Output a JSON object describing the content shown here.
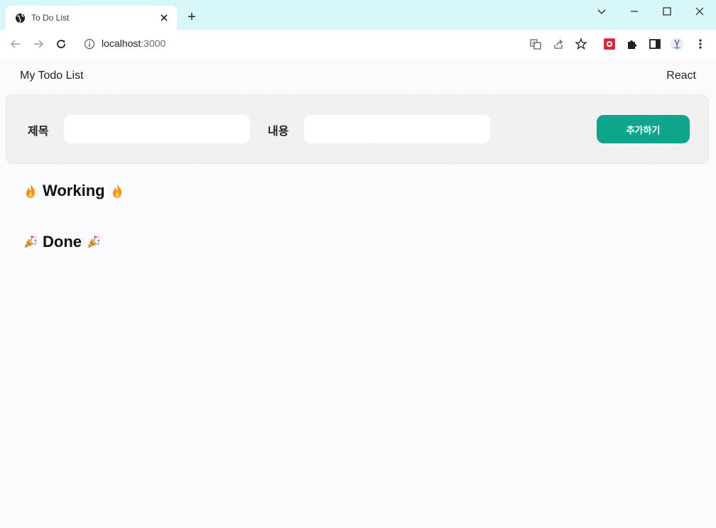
{
  "browser": {
    "tab": {
      "title": "To Do List",
      "close_icon": "close-icon",
      "favicon": "globe-icon"
    },
    "new_tab_symbol": "+",
    "window_controls": [
      "chevron-down-icon",
      "minimize-icon",
      "maximize-icon",
      "close-icon"
    ],
    "address": {
      "host": "localhost",
      "port": ":3000"
    },
    "toolbar_icons": [
      "back-arrow-icon",
      "forward-arrow-icon",
      "reload-icon",
      "info-icon",
      "translate-icon",
      "share-icon",
      "star-icon",
      "extension-red-icon",
      "puzzle-icon",
      "side-panel-icon",
      "profile-avatar",
      "more-menu-icon"
    ]
  },
  "page": {
    "nav": {
      "left": "My Todo List",
      "right": "React"
    },
    "form": {
      "title_label": "제목",
      "title_value": "",
      "content_label": "내용",
      "content_value": "",
      "submit_label": "추가하기"
    },
    "sections": {
      "working": {
        "title": "Working",
        "emoji": "fire-icon"
      },
      "done": {
        "title": "Done",
        "emoji": "party-popper-icon"
      }
    }
  },
  "colors": {
    "tabbar_bg": "#d3f6f8",
    "page_bg": "#fbfbfd",
    "button_bg": "#0ea58c",
    "fire_orange": "#f5a623"
  }
}
